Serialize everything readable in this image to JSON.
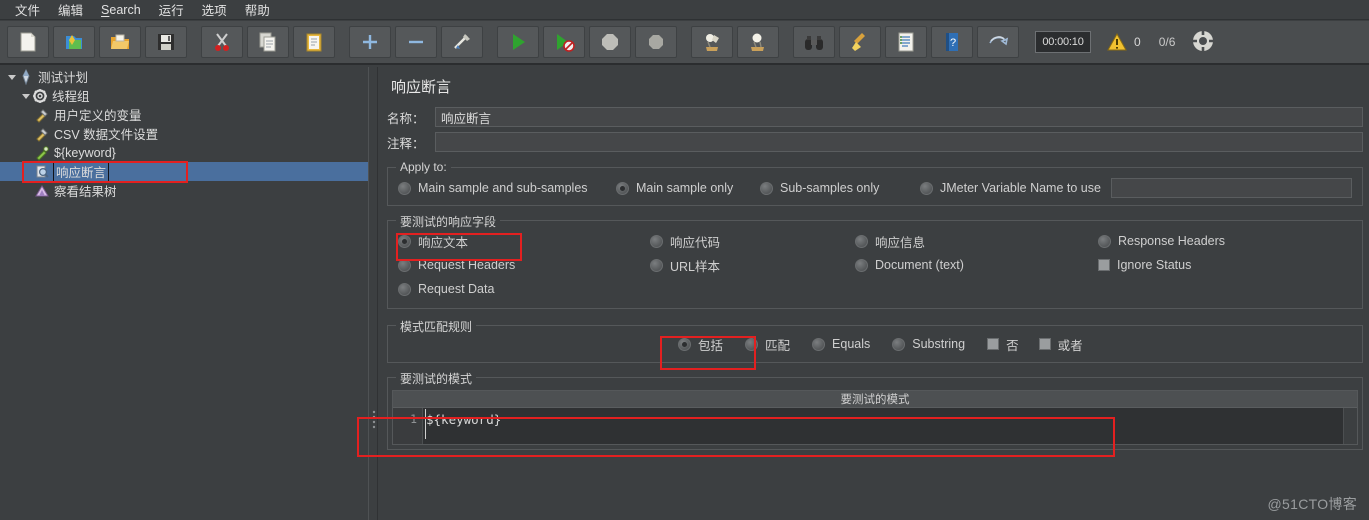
{
  "menu": {
    "items": [
      {
        "label": "文件",
        "mnemonic": ""
      },
      {
        "label": "编辑",
        "mnemonic": ""
      },
      {
        "label": "Search",
        "mnemonic": "S"
      },
      {
        "label": "运行",
        "mnemonic": ""
      },
      {
        "label": "选项",
        "mnemonic": ""
      },
      {
        "label": "帮助",
        "mnemonic": ""
      }
    ]
  },
  "toolbar": {
    "buttons": [
      {
        "name": "new-file-icon",
        "tip": "新建"
      },
      {
        "name": "templates-icon",
        "tip": "模板"
      },
      {
        "name": "open-folder-icon",
        "tip": "打开"
      },
      {
        "name": "save-icon",
        "tip": "保存"
      },
      {
        "name": "cut-icon",
        "tip": "剪切"
      },
      {
        "name": "copy-icon",
        "tip": "复制"
      },
      {
        "name": "paste-icon",
        "tip": "粘贴"
      },
      {
        "name": "expand-all-icon",
        "tip": "展开"
      },
      {
        "name": "collapse-all-icon",
        "tip": "收起"
      },
      {
        "name": "toggle-icon",
        "tip": "启用/禁用"
      },
      {
        "name": "start-icon",
        "tip": "启动"
      },
      {
        "name": "start-no-timers-icon",
        "tip": "无间隔启动"
      },
      {
        "name": "stop-icon",
        "tip": "停止"
      },
      {
        "name": "shutdown-icon",
        "tip": "关闭"
      },
      {
        "name": "clear-icon",
        "tip": "清除"
      },
      {
        "name": "clear-all-icon",
        "tip": "清除全部"
      },
      {
        "name": "search-binoculars-icon",
        "tip": "搜索"
      },
      {
        "name": "reset-search-broom-icon",
        "tip": "重置搜索"
      },
      {
        "name": "function-helper-icon",
        "tip": "函数助手"
      },
      {
        "name": "help-icon",
        "tip": "帮助"
      },
      {
        "name": "undo-icon",
        "tip": "撤销"
      }
    ],
    "timer": "00:00:10",
    "warn_count": "0",
    "threads": "0/6",
    "connection_icon": "connection-icon"
  },
  "tree": {
    "nodes": [
      {
        "label": "测试计划",
        "icon": "test-plan-icon",
        "indent": 0,
        "expanded": true,
        "selected": false
      },
      {
        "label": "线程组",
        "icon": "thread-group-icon",
        "indent": 1,
        "expanded": true,
        "selected": false
      },
      {
        "label": "用户定义的变量",
        "icon": "user-variables-icon",
        "indent": 2,
        "expanded": null,
        "selected": false
      },
      {
        "label": "CSV 数据文件设置",
        "icon": "csv-dataset-icon",
        "indent": 2,
        "expanded": null,
        "selected": false
      },
      {
        "label": "${keyword}",
        "icon": "http-sampler-icon",
        "indent": 2,
        "expanded": null,
        "selected": false
      },
      {
        "label": "响应断言",
        "icon": "assertion-icon",
        "indent": 2,
        "expanded": null,
        "selected": true
      },
      {
        "label": "察看结果树",
        "icon": "view-results-tree-icon",
        "indent": 2,
        "expanded": null,
        "selected": false
      }
    ]
  },
  "panel": {
    "title": "响应断言",
    "name_label": "名称：",
    "name_value": "响应断言",
    "comment_label": "注释：",
    "comment_value": "",
    "apply_to": {
      "legend": "Apply to:",
      "options": [
        {
          "label": "Main sample and sub-samples",
          "selected": false
        },
        {
          "label": "Main sample only",
          "selected": true
        },
        {
          "label": "Sub-samples only",
          "selected": false
        },
        {
          "label": "JMeter Variable Name to use",
          "selected": false
        }
      ],
      "variable_value": ""
    },
    "response_field": {
      "legend": "要测试的响应字段",
      "col1": [
        {
          "label": "响应文本",
          "type": "radio",
          "selected": true
        },
        {
          "label": "Request Headers",
          "type": "radio",
          "selected": false
        },
        {
          "label": "Request Data",
          "type": "radio",
          "selected": false
        }
      ],
      "col2": [
        {
          "label": "响应代码",
          "type": "radio",
          "selected": false
        },
        {
          "label": "URL样本",
          "type": "radio",
          "selected": false
        }
      ],
      "col3": [
        {
          "label": "响应信息",
          "type": "radio",
          "selected": false
        },
        {
          "label": "Document (text)",
          "type": "radio",
          "selected": false
        }
      ],
      "col4": [
        {
          "label": "Response Headers",
          "type": "radio",
          "selected": false
        },
        {
          "label": "Ignore Status",
          "type": "checkbox",
          "selected": false
        }
      ]
    },
    "pattern_rules": {
      "legend": "模式匹配规则",
      "options": [
        {
          "label": "包括",
          "type": "radio",
          "selected": true
        },
        {
          "label": "匹配",
          "type": "radio",
          "selected": false
        },
        {
          "label": "Equals",
          "type": "radio",
          "selected": false
        },
        {
          "label": "Substring",
          "type": "radio",
          "selected": false
        },
        {
          "label": "否",
          "type": "checkbox",
          "selected": false
        },
        {
          "label": "或者",
          "type": "checkbox",
          "selected": false
        }
      ]
    },
    "patterns": {
      "legend": "要测试的模式",
      "column_header": "要测试的模式",
      "rows": [
        {
          "num": "1",
          "value": "${keyword}"
        }
      ]
    }
  },
  "watermark": "@51CTO博客",
  "colors": {
    "window_bg": "#3c3f41",
    "toolbar_bg": "#4a4d4f",
    "selection_blue": "#4a6f9e",
    "annotation_red": "#e32020",
    "text": "#d6d6d6"
  }
}
